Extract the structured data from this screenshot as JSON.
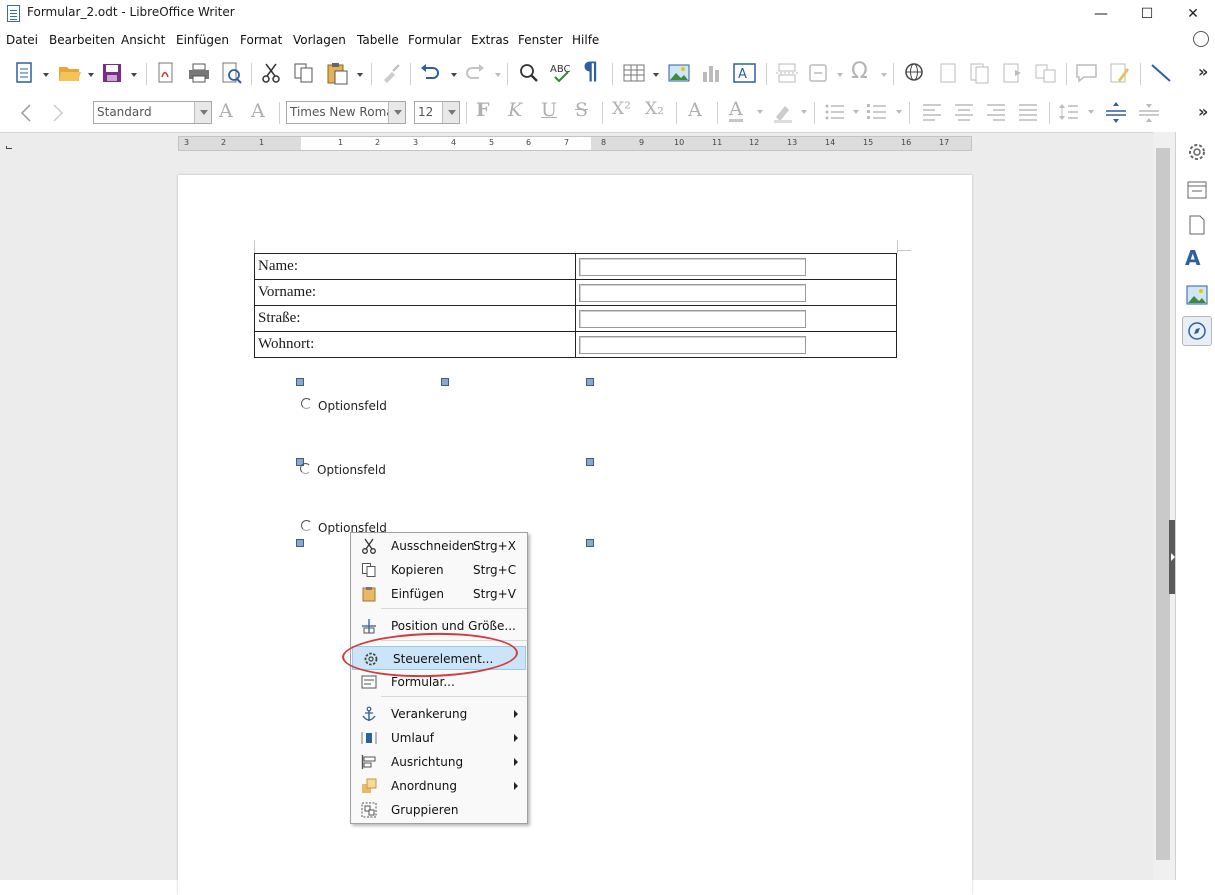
{
  "window": {
    "title": "Formular_2.odt - LibreOffice Writer",
    "minimize": "—",
    "maximize": "☐",
    "close": "✕"
  },
  "menu": [
    "Datei",
    "Bearbeiten",
    "Ansicht",
    "Einfügen",
    "Format",
    "Vorlagen",
    "Tabelle",
    "Formular",
    "Extras",
    "Fenster",
    "Hilfe"
  ],
  "formatting": {
    "paragraph_style": "Standard",
    "font_name": "Times New Roman",
    "font_size": "12"
  },
  "ruler_numbers": [
    "3",
    "2",
    "1",
    "1",
    "2",
    "3",
    "4",
    "5",
    "6",
    "7",
    "8",
    "9",
    "10",
    "11",
    "12",
    "13",
    "14",
    "15",
    "16",
    "17"
  ],
  "form_table": {
    "rows": [
      {
        "label": "Name:"
      },
      {
        "label": "Vorname:"
      },
      {
        "label": "Straße:"
      },
      {
        "label": "Wohnort:"
      }
    ]
  },
  "option_fields": [
    "Optionsfeld",
    "Optionsfeld",
    "Optionsfeld"
  ],
  "context_menu": {
    "items": [
      {
        "label": "Ausschneiden",
        "shortcut": "Strg+X",
        "icon": "scissors-icon"
      },
      {
        "label": "Kopieren",
        "shortcut": "Strg+C",
        "icon": "copy-icon"
      },
      {
        "label": "Einfügen",
        "shortcut": "Strg+V",
        "icon": "paste-icon"
      },
      {
        "label": "Position und Größe...",
        "icon": "position-size-icon"
      },
      {
        "label": "Steuerelement...",
        "icon": "gear-icon",
        "highlighted": true
      },
      {
        "label": "Formular...",
        "icon": "form-icon"
      },
      {
        "label": "Verankerung",
        "submenu": true,
        "icon": "anchor-icon"
      },
      {
        "label": "Umlauf",
        "submenu": true,
        "icon": "wrap-icon"
      },
      {
        "label": "Ausrichtung",
        "submenu": true,
        "icon": "align-icon"
      },
      {
        "label": "Anordnung",
        "submenu": true,
        "icon": "arrange-icon"
      },
      {
        "label": "Gruppieren",
        "icon": "group-icon"
      }
    ]
  },
  "colors": {
    "highlight": "#cce4f7",
    "annotation_red": "#d23b3b",
    "selection_handle": "#8aa8cc"
  }
}
